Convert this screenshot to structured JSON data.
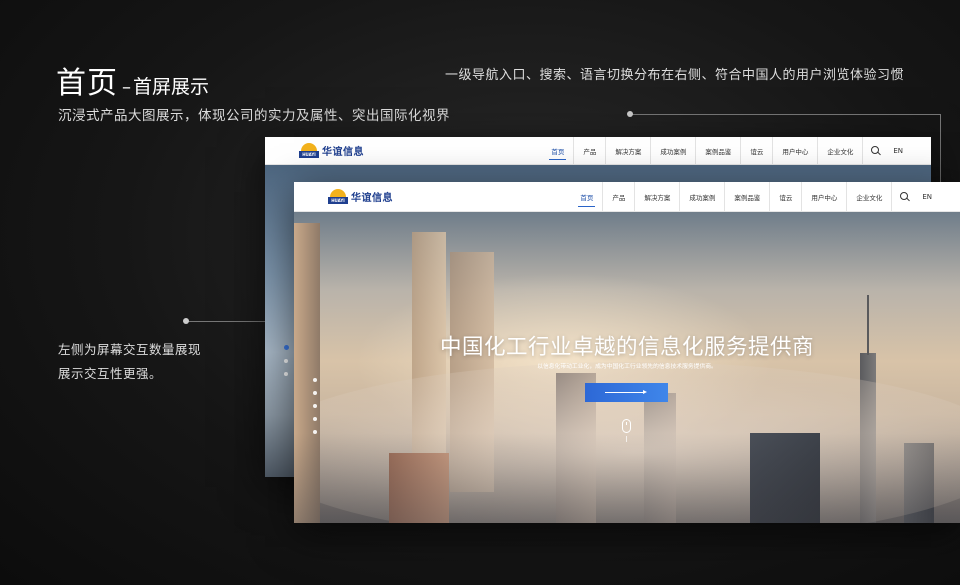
{
  "slide": {
    "title": "首页",
    "title_dash": "–",
    "subtitle": "首屏展示",
    "description": "沉浸式产品大图展示，体现公司的实力及属性、突出国际化视界",
    "nav_note": "一级导航入口、搜索、语言切换分布在右侧、符合中国人的用户浏览体验习惯",
    "left_note_line1": "左侧为屏幕交互数量展现",
    "left_note_line2": "展示交互性更强。"
  },
  "site": {
    "logo_text": "华谊信息",
    "logo_mark_text": "HUAYI",
    "nav": [
      {
        "label": "首页",
        "active": true
      },
      {
        "label": "产品"
      },
      {
        "label": "解决方案"
      },
      {
        "label": "成功案例"
      },
      {
        "label": "案例品鉴"
      },
      {
        "label": "谊云"
      },
      {
        "label": "用户中心"
      },
      {
        "label": "企业文化"
      }
    ],
    "search_icon": "search-icon",
    "lang": "EN"
  },
  "hero": {
    "headline": "中国化工行业卓越的信息化服务提供商",
    "subline": "以信息化带动工业化，成为中国化工行业领先的信息技术服务提供商。",
    "slides_total": 5,
    "active_slide": 1
  },
  "colors": {
    "accent": "#2f6fe0",
    "brand": "#1f3f8f",
    "logo_sun": "#f3b21c"
  }
}
